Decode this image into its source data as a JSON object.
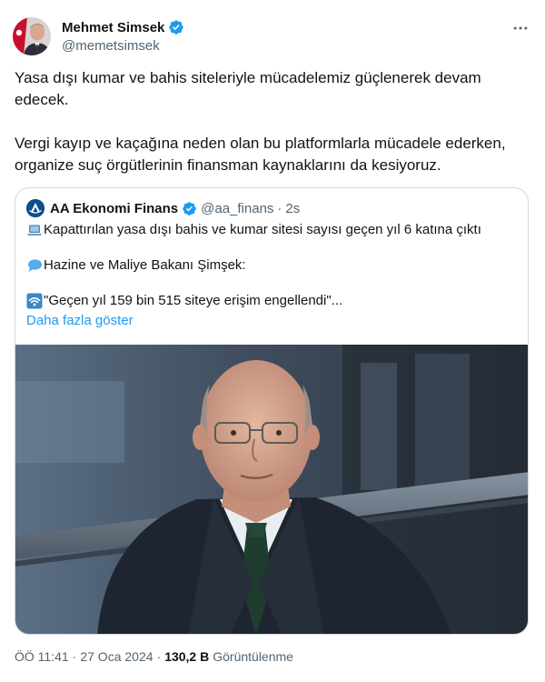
{
  "author": {
    "name": "Mehmet Simsek",
    "handle": "@memetsimsek"
  },
  "icons": {
    "avatar": "avatar-photo",
    "verified": "verified-badge-icon",
    "more": "more-options-icon"
  },
  "tweet": {
    "paragraph_1": "Yasa dışı kumar ve bahis siteleriyle mücadelemiz güçlenerek devam edecek.",
    "paragraph_2": "Vergi kayıp ve kaçağına neden olan bu platformlarla mücadele ederken, organize suç örgütlerinin finansman kaynaklarını da kesiyoruz."
  },
  "quote": {
    "name": "AA Ekonomi Finans",
    "handle": "@aa_finans",
    "separator": "·",
    "time": "2s",
    "line_1": "Kapattırılan yasa dışı bahis ve kumar sitesi sayısı geçen yıl 6 katına çıktı",
    "line_2": "Hazine ve Maliye Bakanı Şimşek:",
    "line_3": "\"Geçen yıl 159 bin 515 siteye erişim engellendi\"...",
    "show_more": "Daha fazla göster",
    "emoji_1": "laptop-emoji",
    "emoji_2": "speech-bubble-emoji",
    "emoji_3": "wifi-signal-emoji"
  },
  "meta": {
    "time": "ÖÖ 11:41",
    "separator": "·",
    "date": "27 Oca 2024",
    "separator_2": "·",
    "views_count": "130,2 B",
    "views_label": "Görüntülenme"
  },
  "colors": {
    "text_primary": "#0f1419",
    "text_secondary": "#536471",
    "link": "#1d9bf0",
    "verified": "#1d9bf0",
    "border": "#cfd9de"
  }
}
